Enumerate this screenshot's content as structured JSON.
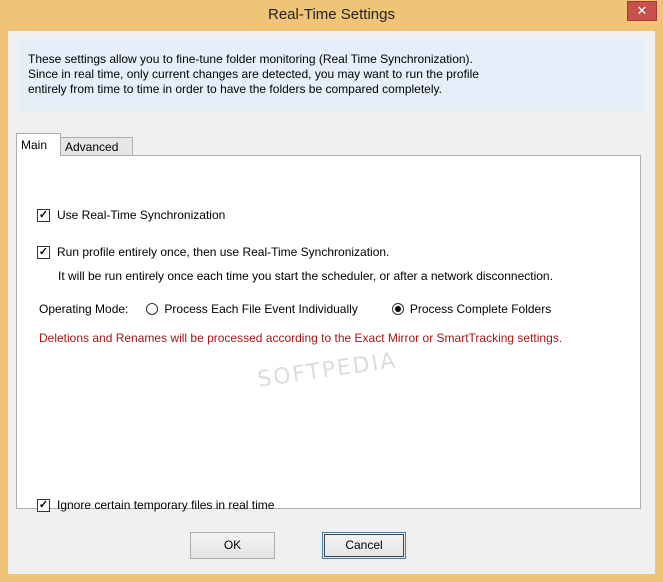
{
  "window": {
    "title": "Real-Time Settings",
    "close_glyph": "✕"
  },
  "info": {
    "lines": [
      "These settings allow you to fine-tune folder monitoring (Real Time Synchronization).",
      "Since in real time, only current changes are detected, you may want to run the profile",
      "entirely from time to time in order to have the folders be compared completely."
    ]
  },
  "tabs": [
    {
      "label": "Main",
      "active": true
    },
    {
      "label": "Advanced",
      "active": false
    }
  ],
  "main": {
    "use_realtime": {
      "label": "Use Real-Time Synchronization",
      "checked": true
    },
    "run_once": {
      "label": "Run profile entirely once, then use Real-Time Synchronization.",
      "checked": true
    },
    "run_once_note": "It will be run entirely once each time you start the scheduler, or after a network disconnection.",
    "operating_mode": {
      "label": "Operating Mode:",
      "options": [
        {
          "label": "Process Each File Event Individually",
          "selected": false
        },
        {
          "label": "Process Complete Folders",
          "selected": true
        }
      ]
    },
    "warning": "Deletions and Renames will be processed according to the Exact Mirror or SmartTracking settings.",
    "warning_color": "#a01818",
    "ignore_temp": {
      "label": "Ignore certain temporary files in real time",
      "checked": true
    }
  },
  "buttons": {
    "ok": "OK",
    "cancel": "Cancel"
  },
  "watermark": "SOFTPEDIA",
  "colors": {
    "frame": "#f0c477",
    "close": "#c7504c",
    "info_bg": "#e5effa"
  }
}
